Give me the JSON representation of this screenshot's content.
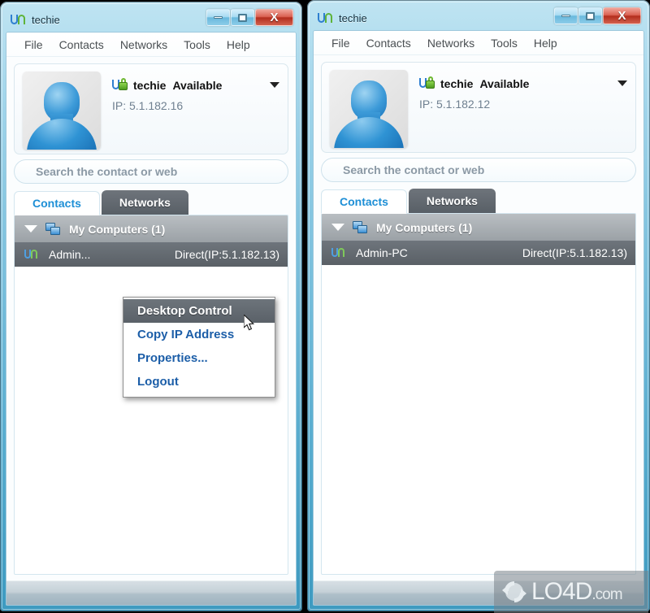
{
  "app": {
    "title": "techie",
    "logo_icon": "uu-app-logo-icon"
  },
  "window_buttons": {
    "minimize": "minimize-icon",
    "maximize": "maximize-icon",
    "close": "X"
  },
  "menubar": {
    "items": [
      {
        "label": "File"
      },
      {
        "label": "Contacts"
      },
      {
        "label": "Networks"
      },
      {
        "label": "Tools"
      },
      {
        "label": "Help"
      }
    ]
  },
  "left_window": {
    "title": "techie",
    "profile": {
      "username": "techie",
      "status": "Available",
      "ip": "IP: 5.1.182.16",
      "status_icon": "secure-lock-icon",
      "avatar": "user-avatar",
      "dropdown_icon": "chevron-down-icon"
    },
    "search": {
      "placeholder": "Search the contact or web",
      "value": ""
    },
    "tabs": [
      {
        "label": "Contacts",
        "active": true
      },
      {
        "label": "Networks",
        "active": false
      }
    ],
    "list": {
      "group": {
        "label": "My Computers (1)",
        "icon": "computers-icon",
        "expanded_icon": "triangle-down-icon"
      },
      "rows": [
        {
          "name": "Admin...",
          "connection": "Direct(IP:5.1.182.13)",
          "icon": "uu-contact-icon"
        }
      ]
    },
    "context_menu": {
      "items": [
        {
          "label": "Desktop Control",
          "highlighted": true
        },
        {
          "label": "Copy IP Address",
          "highlighted": false
        },
        {
          "label": "Properties...",
          "highlighted": false
        },
        {
          "label": "Logout",
          "highlighted": false
        }
      ]
    }
  },
  "right_window": {
    "title": "techie",
    "profile": {
      "username": "techie",
      "status": "Available",
      "ip": "IP: 5.1.182.12",
      "status_icon": "secure-lock-icon",
      "avatar": "user-avatar",
      "dropdown_icon": "chevron-down-icon"
    },
    "search": {
      "placeholder": "Search the contact or web",
      "value": ""
    },
    "tabs": [
      {
        "label": "Contacts",
        "active": true
      },
      {
        "label": "Networks",
        "active": false
      }
    ],
    "list": {
      "group": {
        "label": "My Computers (1)",
        "icon": "computers-icon",
        "expanded_icon": "triangle-down-icon"
      },
      "rows": [
        {
          "name": "Admin-PC",
          "connection": "Direct(IP:5.1.182.13)",
          "icon": "uu-contact-icon"
        }
      ]
    }
  },
  "watermark": {
    "name": "LO4D",
    "suffix": ".com",
    "icon": "refresh-circle-icon"
  },
  "colors": {
    "accent_blue": "#1e8fd6",
    "link_blue": "#1c5ea8",
    "tab_inactive": "#5a6066",
    "window_chrome": "#7fc2de",
    "close_red": "#b32d1d",
    "status_green": "#5fb33a"
  }
}
